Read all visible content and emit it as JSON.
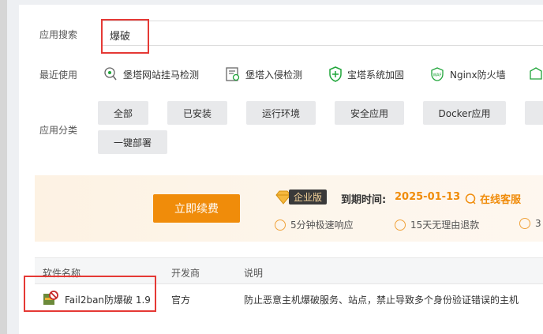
{
  "search": {
    "label": "应用搜索",
    "value": "爆破"
  },
  "recent": {
    "label": "最近使用",
    "items": [
      {
        "label": "堡塔网站挂马检测",
        "icon": "scan-virus-icon"
      },
      {
        "label": "堡塔入侵检测",
        "icon": "intrusion-detect-icon"
      },
      {
        "label": "宝塔系统加固",
        "icon": "shield-plus-icon"
      },
      {
        "label": "Nginx防火墙",
        "icon": "waf-icon"
      }
    ]
  },
  "categories": {
    "label": "应用分类",
    "items": [
      "全部",
      "已安装",
      "运行环境",
      "安全应用",
      "Docker应用",
      "一键部署"
    ]
  },
  "promo": {
    "renew_button": "立即续费",
    "edition": "企业版",
    "expire_label": "到期时间:",
    "expire_date": "2025-01-13",
    "service_link": "在线客服",
    "perks": [
      "5分钟极速响应",
      "15天无理由退款",
      "3"
    ]
  },
  "table": {
    "headers": [
      "软件名称",
      "开发商",
      "说明"
    ],
    "rows": [
      {
        "name": "Fail2ban防爆破 1.9",
        "vendor": "官方",
        "desc": "防止恶意主机爆破服务、站点，禁止导致多个身份验证错误的主机"
      }
    ]
  },
  "colors": {
    "accent": "#f08c0a",
    "highlight_box": "#e53935"
  }
}
